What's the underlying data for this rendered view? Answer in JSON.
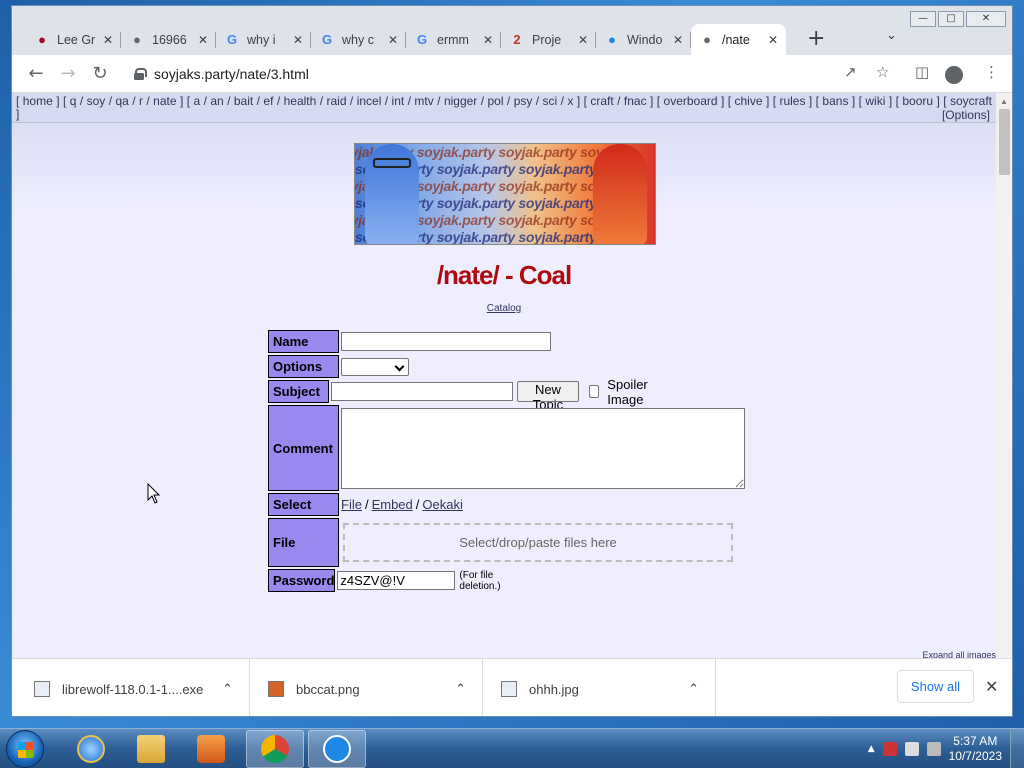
{
  "browser": {
    "tabs": [
      {
        "title": "Lee Gr",
        "favicon": "wiki-icon",
        "color": "#b00020"
      },
      {
        "title": "16966",
        "favicon": "soyjak-icon",
        "color": "#666"
      },
      {
        "title": "why i",
        "favicon": "google-icon",
        "color": "#4285f4"
      },
      {
        "title": "why c",
        "favicon": "google-icon",
        "color": "#4285f4"
      },
      {
        "title": "ermm",
        "favicon": "google-icon",
        "color": "#4285f4"
      },
      {
        "title": "Proje",
        "favicon": "2025-icon",
        "color": "#c0392b"
      },
      {
        "title": "Windo",
        "favicon": "librewolf-icon",
        "color": "#1e88e5"
      },
      {
        "title": "/nate",
        "favicon": "soyjak-icon",
        "color": "#666"
      }
    ],
    "url": "soyjaks.party/nate/3.html"
  },
  "page": {
    "boardlist": "[ home ] [ q / soy / qa / r / nate ] [ a / an / bait / ef / health / raid / incel / int / mtv / nigger / pol / psy / sci / x ] [ craft / fnac ] [ overboard ] [ chive ] [ rules ] [ bans ] [ wiki ] [ booru ] [ soycraft ]",
    "options_link": "[Options]",
    "banner_text": "soyjak.party soyjak.party soyjak.party soy",
    "title": "/nate/ - Coal",
    "catalog": "Catalog",
    "form": {
      "name_label": "Name",
      "options_label": "Options",
      "subject_label": "Subject",
      "new_topic": "New Topic",
      "spoiler": "Spoiler Image",
      "comment_label": "Comment",
      "select_label": "Select",
      "select_file": "File",
      "select_embed": "Embed",
      "select_oekaki": "Oekaki",
      "sep": "/",
      "file_label": "File",
      "dropzone": "Select/drop/paste files here",
      "password_label": "Password",
      "password_value": "z4SZV@!V",
      "password_note": "(For file deletion.)"
    },
    "expand_all": "Expand all images"
  },
  "downloads": {
    "items": [
      {
        "name": "librewolf-118.0.1-1....exe"
      },
      {
        "name": "bbccat.png"
      },
      {
        "name": "ohhh.jpg"
      }
    ],
    "show_all": "Show all"
  },
  "taskbar": {
    "time": "5:37 AM",
    "date": "10/7/2023"
  }
}
